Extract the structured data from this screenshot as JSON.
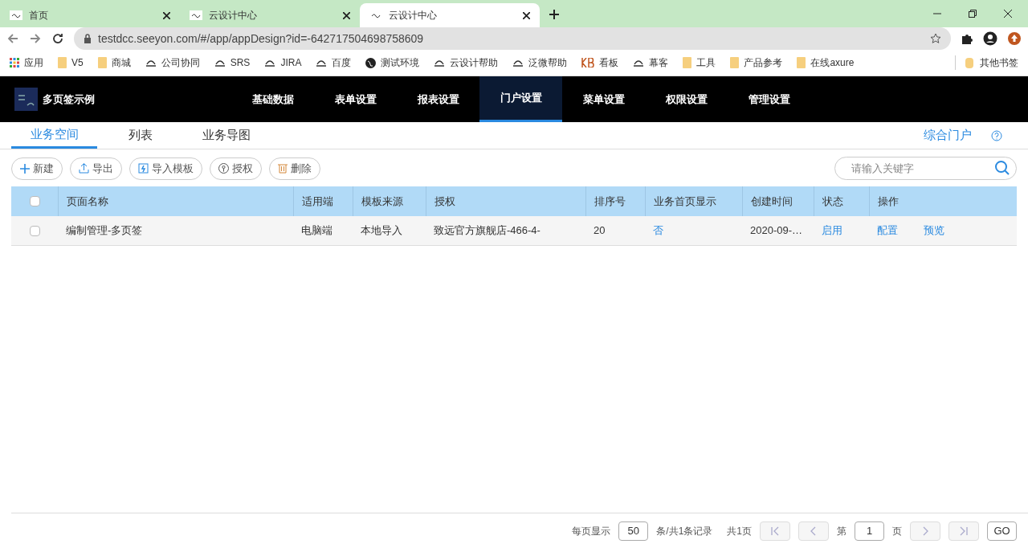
{
  "browser": {
    "tabs": [
      {
        "title": "首页",
        "selected": false
      },
      {
        "title": "云设计中心",
        "selected": false
      },
      {
        "title": "云设计中心",
        "selected": true
      }
    ],
    "url": "testdcc.seeyon.com/#/app/appDesign?id=-642717504698758609",
    "bookmarks": [
      {
        "label": "应用",
        "kind": "apps"
      },
      {
        "label": "V5",
        "kind": "folder"
      },
      {
        "label": "商城",
        "kind": "folder"
      },
      {
        "label": "公司协同",
        "kind": "site"
      },
      {
        "label": "SRS",
        "kind": "site"
      },
      {
        "label": "JIRA",
        "kind": "site"
      },
      {
        "label": "百度",
        "kind": "site"
      },
      {
        "label": "测试环境",
        "kind": "globe"
      },
      {
        "label": "云设计帮助",
        "kind": "site"
      },
      {
        "label": "泛微帮助",
        "kind": "site"
      },
      {
        "label": "看板",
        "kind": "kb"
      },
      {
        "label": "幕客",
        "kind": "site"
      },
      {
        "label": "工具",
        "kind": "folder"
      },
      {
        "label": "产品参考",
        "kind": "folder"
      },
      {
        "label": "在线axure",
        "kind": "folder"
      }
    ],
    "other_bookmarks": "其他书签"
  },
  "app": {
    "title": "多页签示例",
    "nav": [
      {
        "label": "基础数据",
        "selected": false
      },
      {
        "label": "表单设置",
        "selected": false
      },
      {
        "label": "报表设置",
        "selected": false
      },
      {
        "label": "门户设置",
        "selected": true
      },
      {
        "label": "菜单设置",
        "selected": false
      },
      {
        "label": "权限设置",
        "selected": false
      },
      {
        "label": "管理设置",
        "selected": false
      }
    ]
  },
  "subtabs": [
    {
      "label": "业务空间",
      "selected": true
    },
    {
      "label": "列表",
      "selected": false
    },
    {
      "label": "业务导图",
      "selected": false
    }
  ],
  "portal_link": "综合门户",
  "toolbar": [
    {
      "label": "新建",
      "kind": "plus"
    },
    {
      "label": "导出",
      "kind": "export"
    },
    {
      "label": "导入模板",
      "kind": "import"
    },
    {
      "label": "授权",
      "kind": "auth"
    },
    {
      "label": "删除",
      "kind": "delete"
    }
  ],
  "search": {
    "placeholder": "请输入关键字"
  },
  "table": {
    "all_checked": false,
    "columns": [
      "页面名称",
      "适用端",
      "模板来源",
      "授权",
      "排序号",
      "业务首页显示",
      "创建时间",
      "状态",
      "操作"
    ],
    "rows": [
      {
        "checked": false,
        "cells": [
          {
            "text": "编制管理-多页签",
            "link": false
          },
          {
            "text": "电脑端",
            "link": false
          },
          {
            "text": "本地导入",
            "link": false
          },
          {
            "text": "致远官方旗舰店-466-4-",
            "link": false
          },
          {
            "text": "20",
            "link": false
          },
          {
            "text": "否",
            "link": true
          },
          {
            "text": "2020-09-…",
            "link": false
          },
          {
            "text": "启用",
            "link": true
          }
        ],
        "actions": [
          "配置",
          "预览"
        ]
      }
    ]
  },
  "pagination": {
    "per_page_label": "每页显示",
    "per_page": "50",
    "records": "条/共1条记录",
    "pages": "共1页",
    "page_prefix": "第",
    "page": "1",
    "page_suffix": "页",
    "go": "GO"
  }
}
